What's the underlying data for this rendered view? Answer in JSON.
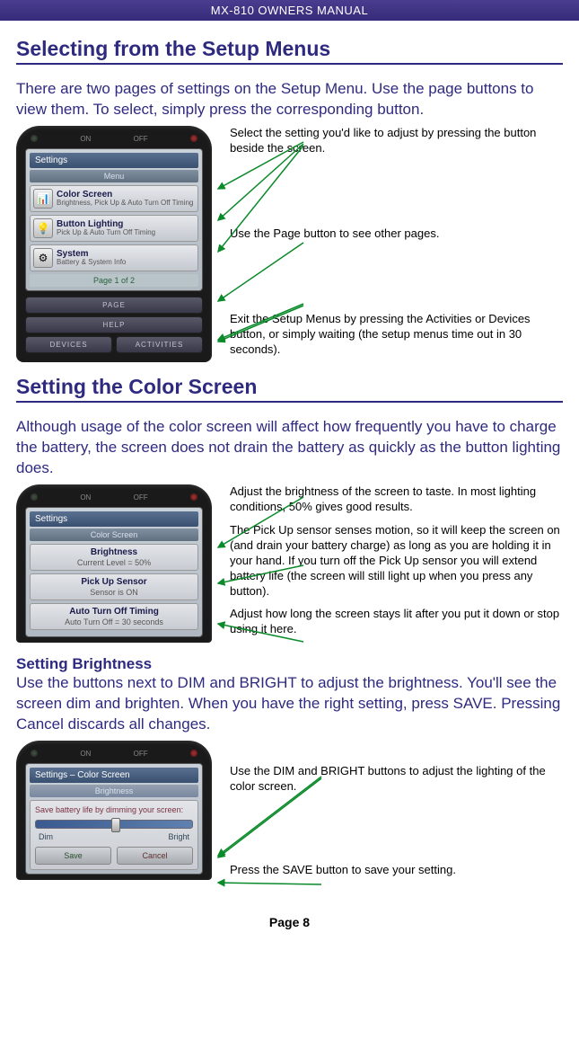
{
  "manual_title": "MX-810 OWNERS MANUAL",
  "section1": {
    "heading": "Selecting from the Setup Menus",
    "intro": "There are two pages of settings on the Setup Menu. Use the page buttons to view them. To select, simply press the corresponding button.",
    "callouts": {
      "c1": "Select the setting you'd like to adjust by pressing the button beside the screen.",
      "c2": "Use the Page button to see other pages.",
      "c3": "Exit the Setup Menus by pressing the Activities or Devices button, or simply waiting (the setup menus time out in 30 seconds)."
    },
    "remote": {
      "on": "ON",
      "off": "OFF",
      "title": "Settings",
      "subtitle": "Menu",
      "items": [
        {
          "name": "Color Screen",
          "desc": "Brightness, Pick Up & Auto Turn Off Timing",
          "icon": "chart"
        },
        {
          "name": "Button Lighting",
          "desc": "Pick Up & Auto Turn Off Timing",
          "icon": "light"
        },
        {
          "name": "System",
          "desc": "Battery & System Info",
          "icon": "gear"
        }
      ],
      "page_indicator": "Page 1 of 2",
      "btn_page": "PAGE",
      "btn_help": "HELP",
      "btn_devices": "DEVICES",
      "btn_activities": "ACTIVITIES"
    }
  },
  "section2": {
    "heading": "Setting the Color Screen",
    "intro": "Although usage of the color screen will affect how frequently you have to charge the battery, the screen does not drain the battery as quickly as the button lighting does.",
    "callouts": {
      "c1": "Adjust the brightness of the screen to taste. In most lighting conditions, 50% gives good results.",
      "c2": "The Pick Up sensor senses motion, so it will keep the screen on (and drain your battery charge) as long as you are holding it in your hand. If you turn off the Pick Up sensor you will extend battery life (the screen will still light up when you press any button).",
      "c3": "Adjust how long the screen stays lit after you put it down or stop using it here."
    },
    "remote": {
      "on": "ON",
      "off": "OFF",
      "title": "Settings",
      "subtitle": "Color Screen",
      "items": [
        {
          "name": "Brightness",
          "desc": "Current Level = 50%"
        },
        {
          "name": "Pick Up Sensor",
          "desc": "Sensor is ON"
        },
        {
          "name": "Auto Turn Off Timing",
          "desc": "Auto Turn Off = 30 seconds"
        }
      ]
    },
    "sub_heading": "Setting Brightness",
    "sub_body": "Use the buttons next to DIM and BRIGHT to adjust the brightness. You'll see the screen dim and brighten. When you have the right setting, press SAVE. Pressing Cancel discards all changes."
  },
  "section3": {
    "callouts": {
      "c1": "Use the DIM and BRIGHT buttons to adjust the lighting of the color screen.",
      "c2": "Press the SAVE button to save your setting."
    },
    "remote": {
      "on": "ON",
      "off": "OFF",
      "title": "Settings – Color Screen",
      "subtitle": "Brightness",
      "message": "Save battery life by dimming your screen:",
      "dim": "Dim",
      "bright": "Bright",
      "save": "Save",
      "cancel": "Cancel"
    }
  },
  "footer": "Page 8"
}
